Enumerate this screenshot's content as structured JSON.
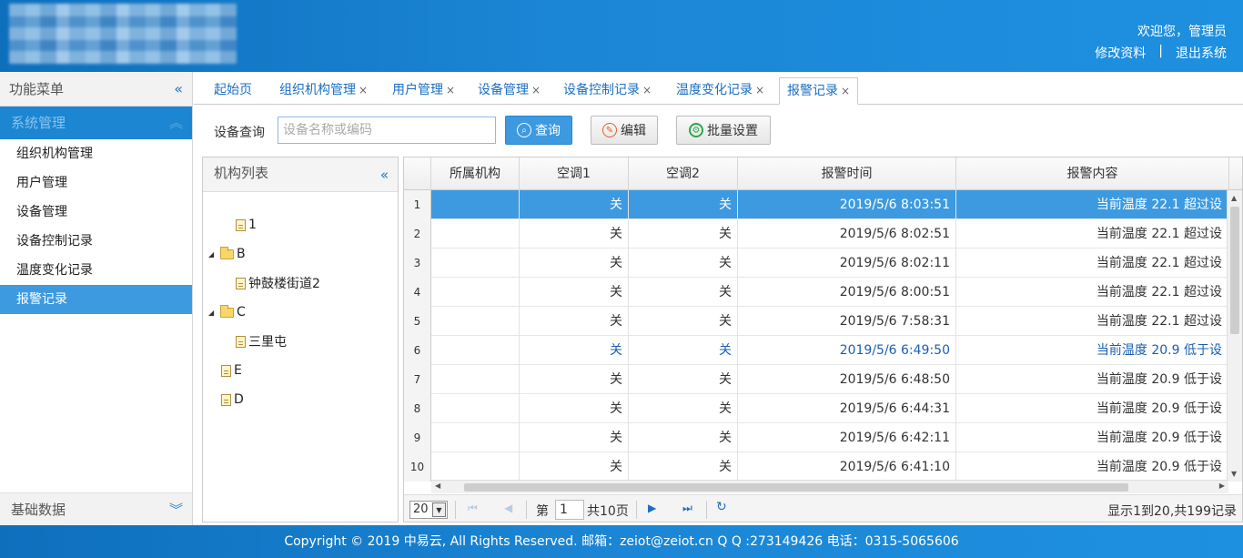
{
  "header": {
    "welcome": "欢迎您，管理员",
    "edit_profile": "修改资料",
    "separator": "|",
    "logout": "退出系统"
  },
  "leftmenu": {
    "title": "功能菜单",
    "group": "系统管理",
    "items": [
      {
        "label": "组织机构管理"
      },
      {
        "label": "用户管理"
      },
      {
        "label": "设备管理"
      },
      {
        "label": "设备控制记录"
      },
      {
        "label": "温度变化记录"
      },
      {
        "label": "报警记录"
      }
    ],
    "active_index": 5,
    "footer_group": "基础数据"
  },
  "tabs": [
    {
      "label": "起始页",
      "closable": false
    },
    {
      "label": "组织机构管理",
      "closable": true
    },
    {
      "label": "用户管理",
      "closable": true
    },
    {
      "label": "设备管理",
      "closable": true
    },
    {
      "label": "设备控制记录",
      "closable": true
    },
    {
      "label": "温度变化记录",
      "closable": true
    },
    {
      "label": "报警记录",
      "closable": true
    }
  ],
  "toolbar": {
    "label": "设备查询",
    "placeholder": "设备名称或编码",
    "query": "查询",
    "edit": "编辑",
    "batch": "批量设置"
  },
  "org": {
    "title": "机构列表",
    "nodes": [
      {
        "label": "1",
        "type": "file",
        "level": 1
      },
      {
        "label": "B",
        "type": "folder",
        "level": 0
      },
      {
        "label": "钟鼓楼街道2",
        "type": "file",
        "level": 1
      },
      {
        "label": "C",
        "type": "folder",
        "level": 0
      },
      {
        "label": "三里屯",
        "type": "file",
        "level": 1
      },
      {
        "label": "E",
        "type": "file",
        "level": 0
      },
      {
        "label": "D",
        "type": "file",
        "level": 0
      }
    ]
  },
  "grid": {
    "columns": [
      "所属机构",
      "空调1",
      "空调2",
      "报警时间",
      "报警内容"
    ],
    "rows": [
      {
        "n": "1",
        "org": "",
        "ac1": "关",
        "ac2": "关",
        "time": "2019/5/6 8:03:51",
        "content": "当前温度 22.1 超过设"
      },
      {
        "n": "2",
        "org": "",
        "ac1": "关",
        "ac2": "关",
        "time": "2019/5/6 8:02:51",
        "content": "当前温度 22.1 超过设"
      },
      {
        "n": "3",
        "org": "",
        "ac1": "关",
        "ac2": "关",
        "time": "2019/5/6 8:02:11",
        "content": "当前温度 22.1 超过设"
      },
      {
        "n": "4",
        "org": "",
        "ac1": "关",
        "ac2": "关",
        "time": "2019/5/6 8:00:51",
        "content": "当前温度 22.1 超过设"
      },
      {
        "n": "5",
        "org": "",
        "ac1": "关",
        "ac2": "关",
        "time": "2019/5/6 7:58:31",
        "content": "当前温度 22.1 超过设"
      },
      {
        "n": "6",
        "org": "",
        "ac1": "关",
        "ac2": "关",
        "time": "2019/5/6 6:49:50",
        "content": "当前温度 20.9 低于设"
      },
      {
        "n": "7",
        "org": "",
        "ac1": "关",
        "ac2": "关",
        "time": "2019/5/6 6:48:50",
        "content": "当前温度 20.9 低于设"
      },
      {
        "n": "8",
        "org": "",
        "ac1": "关",
        "ac2": "关",
        "time": "2019/5/6 6:44:31",
        "content": "当前温度 20.9 低于设"
      },
      {
        "n": "9",
        "org": "",
        "ac1": "关",
        "ac2": "关",
        "time": "2019/5/6 6:42:11",
        "content": "当前温度 20.9 低于设"
      },
      {
        "n": "10",
        "org": "",
        "ac1": "关",
        "ac2": "关",
        "time": "2019/5/6 6:41:10",
        "content": "当前温度 20.9 低于设"
      }
    ],
    "selected_row": 0,
    "highlight_row": 5
  },
  "pager": {
    "page_size": "20",
    "page_prefix": "第",
    "page": "1",
    "page_suffix": "共10页",
    "info": "显示1到20,共199记录"
  },
  "footer": {
    "text": "Copyright © 2019 中易云, All Rights Reserved. 邮箱：zeiot@zeiot.cn Q Q :273149426 电话：0315-5065606"
  },
  "colors": {
    "brand_blue": "#1b86d5",
    "accent": "#3d9ae0",
    "link": "#1a6fc0"
  },
  "icons": {
    "collapse": "double-chevron-left-icon",
    "expand": "double-chevron-down-icon",
    "search": "search-icon",
    "edit": "edit-icon",
    "settings": "gear-icon"
  }
}
